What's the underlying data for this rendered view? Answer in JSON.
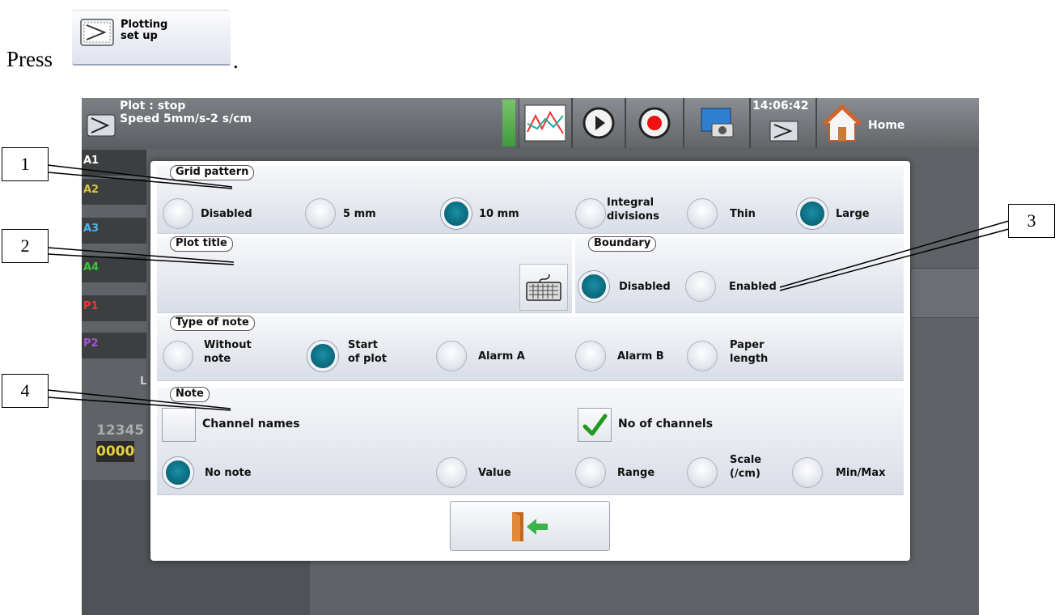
{
  "intro": {
    "press": "Press",
    "period": "."
  },
  "plot_button": {
    "line1": "Plotting",
    "line2": "set up"
  },
  "status": {
    "line1": "Plot : stop",
    "line2": "Speed 5mm/s-2 s/cm",
    "clock": "14:06:42",
    "home": "Home"
  },
  "background": {
    "channels": [
      "A1",
      "A2",
      "A3",
      "A4",
      "P1",
      "P2"
    ],
    "channel_colors": [
      "#ffffff",
      "#d6c24a",
      "#4fb2e8",
      "#3ec43e",
      "#e23b3b",
      "#a356d6"
    ],
    "fragments": {
      "l": "L",
      "digits1": "12345",
      "digits2": "0000"
    }
  },
  "dialog": {
    "grid_pattern": {
      "title": "Grid pattern",
      "options": [
        {
          "label": "Disabled",
          "selected": false
        },
        {
          "label": "5 mm",
          "selected": false
        },
        {
          "label": "10 mm",
          "selected": true
        },
        {
          "label_line1": "Integral",
          "label_line2": "divisions",
          "selected": false
        },
        {
          "label": "Thin",
          "selected": false
        },
        {
          "label": "Large",
          "selected": true
        }
      ]
    },
    "plot_title": {
      "title": "Plot title",
      "value": ""
    },
    "boundary": {
      "title": "Boundary",
      "options": [
        {
          "label": "Disabled",
          "selected": true
        },
        {
          "label": "Enabled",
          "selected": false
        }
      ]
    },
    "type_of_note": {
      "title": "Type of note",
      "options": [
        {
          "label_line1": "Without",
          "label_line2": "note",
          "selected": false
        },
        {
          "label_line1": "Start",
          "label_line2": "of plot",
          "selected": true
        },
        {
          "label": "Alarm A",
          "selected": false
        },
        {
          "label": "Alarm B",
          "selected": false
        },
        {
          "label_line1": "Paper",
          "label_line2": "length",
          "selected": false
        }
      ]
    },
    "note": {
      "title": "Note",
      "checkboxes": [
        {
          "label": "Channel names",
          "checked": false
        },
        {
          "label": "No of channels",
          "checked": true
        }
      ],
      "options": [
        {
          "label": "No note",
          "selected": true
        },
        {
          "label": "Value",
          "selected": false
        },
        {
          "label": "Range",
          "selected": false
        },
        {
          "label_line1": "Scale",
          "label_line2": "(/cm)",
          "selected": false
        },
        {
          "label": "Min/Max",
          "selected": false
        }
      ]
    }
  },
  "callouts": [
    "1",
    "2",
    "3",
    "4"
  ],
  "colors": {
    "accent": "#0c7f95",
    "panel": "#dfe3ea",
    "screen_bg": "#5f6266",
    "check": "#1e9a1e"
  }
}
